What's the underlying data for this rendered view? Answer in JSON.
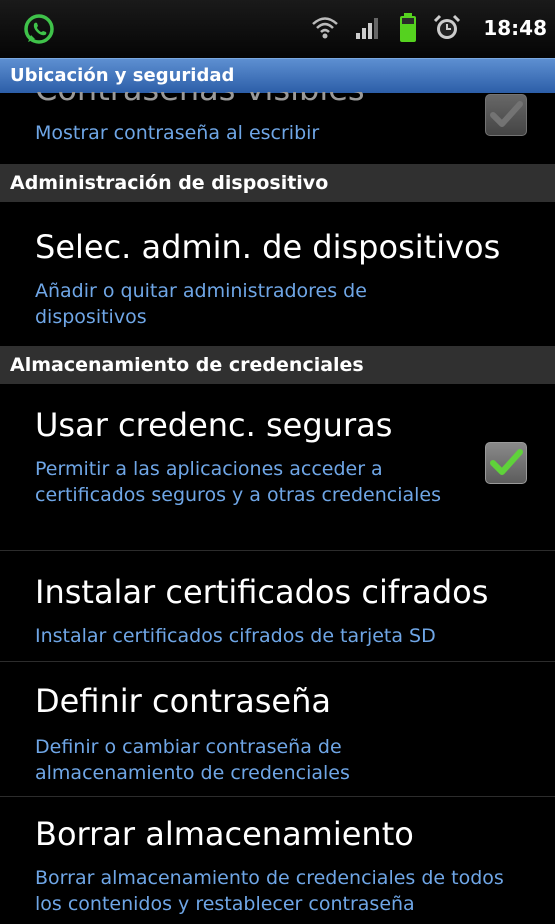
{
  "status_bar": {
    "time": "18:48",
    "icons": [
      "whatsapp-icon",
      "wifi-icon",
      "signal-icon",
      "battery-icon",
      "alarm-icon"
    ]
  },
  "title_bar": {
    "title": "Ubicación y seguridad"
  },
  "list": {
    "partial_item": {
      "title": "Contraseñas visibles",
      "subtitle": "Mostrar contraseña al escribir",
      "checked": true
    },
    "sections": [
      {
        "header": "Administración de dispositivo",
        "items": [
          {
            "title": "Selec. admin. de dispositivos",
            "subtitle": "Añadir o quitar administradores de dispositivos"
          }
        ]
      },
      {
        "header": "Almacenamiento de credenciales",
        "items": [
          {
            "title": "Usar credenc. seguras",
            "subtitle": "Permitir a las aplicaciones acceder a certificados seguros y a otras credenciales",
            "checked": true
          },
          {
            "title": "Instalar certificados cifrados",
            "subtitle": "Instalar certificados cifrados de tarjeta SD"
          },
          {
            "title": "Definir contraseña",
            "subtitle": "Definir o cambiar contraseña de almacenamiento de credenciales"
          },
          {
            "title": "Borrar almacenamiento",
            "subtitle": "Borrar almacenamiento de credenciales de todos los contenidos y restablecer contraseña"
          }
        ]
      }
    ]
  },
  "colors": {
    "subtitle_blue": "#6fa6e6",
    "title_bar_blue": "#3d72be",
    "check_green": "#5fd23a",
    "whatsapp_green": "#3fc24a",
    "battery_green": "#55d21f"
  }
}
